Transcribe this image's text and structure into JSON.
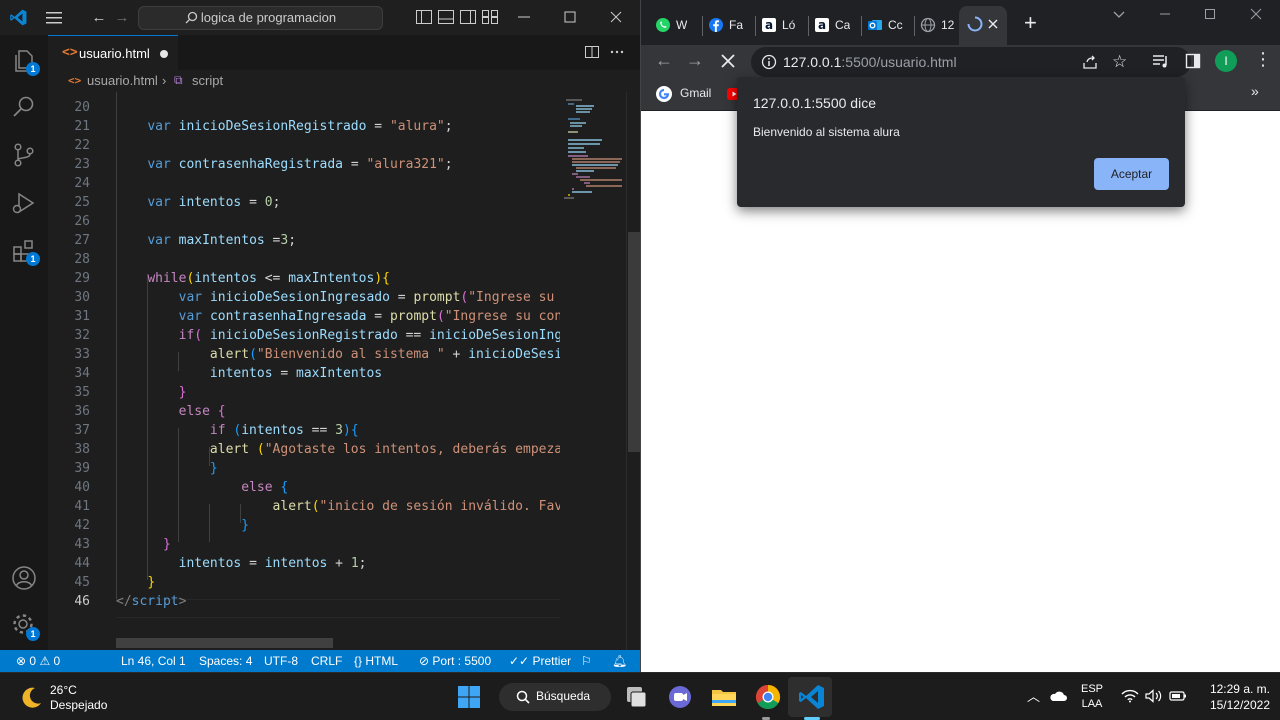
{
  "vscode": {
    "search_text": "logica de programacion",
    "tab": {
      "label": "usuario.html",
      "icon": "<>"
    },
    "breadcrumb": {
      "file": "usuario.html",
      "symbol": "script"
    },
    "activity_badges": {
      "explorer": "1",
      "extensions": "1",
      "settings": "1"
    },
    "status": {
      "problems": "0",
      "warnings": "0",
      "position": "Ln 46, Col 1",
      "spaces": "Spaces: 4",
      "encoding": "UTF-8",
      "eol": "CRLF",
      "language": "HTML",
      "port": "Port : 5500",
      "prettier": "Prettier"
    },
    "line_numbers": [
      "20",
      "21",
      "22",
      "23",
      "24",
      "25",
      "26",
      "27",
      "28",
      "29",
      "30",
      "31",
      "32",
      "33",
      "34",
      "35",
      "36",
      "37",
      "38",
      "39",
      "40",
      "41",
      "42",
      "43",
      "44",
      "45",
      "46"
    ],
    "code": {
      "l21": [
        "var",
        "inicioDeSesionRegistrado",
        " = ",
        "\"alura\"",
        ";"
      ],
      "l23": [
        "var",
        "contrasenhaRegistrada",
        " = ",
        "\"alura321\"",
        ";"
      ],
      "l25": [
        "var",
        "intentos",
        " = ",
        "0",
        ";"
      ],
      "l27": [
        "var",
        "maxIntentos",
        " =",
        "3",
        ";"
      ],
      "l29": [
        "while",
        "(",
        "intentos",
        " <= ",
        "maxIntentos",
        ")",
        "{"
      ],
      "l30": [
        "var",
        "inicioDeSesionIngresado",
        " = ",
        "prompt",
        "(",
        "\"Ingrese su u"
      ],
      "l31": [
        "var",
        "contrasenhaIngresada",
        " = ",
        "prompt",
        "(",
        "\"Ingrese su cont"
      ],
      "l32": [
        "if",
        "( ",
        "inicioDeSesionRegistrado",
        " == ",
        "inicioDeSesionIngr"
      ],
      "l33": [
        "alert",
        "(",
        "\"Bienvenido al sistema \"",
        " + ",
        "inicioDeSesio"
      ],
      "l34": [
        "intentos",
        " = ",
        "maxIntentos"
      ],
      "l35": [
        "}"
      ],
      "l36": [
        "else",
        " ",
        "{"
      ],
      "l37": [
        "if",
        " (",
        "intentos",
        " == ",
        "3",
        ")",
        "{"
      ],
      "l38": [
        "alert",
        " (",
        "\"Agotaste los intentos, deberás empezar"
      ],
      "l39": [
        "}"
      ],
      "l40": [
        "else",
        " ",
        "{"
      ],
      "l41": [
        "alert",
        "(",
        "\"inicio de sesión inválido. Favo"
      ],
      "l42": [
        "}"
      ],
      "l43": [
        "}"
      ],
      "l44": [
        "intentos",
        " = ",
        "intentos",
        " + ",
        "1",
        ";"
      ],
      "l45": [
        "}"
      ],
      "l46": [
        "</",
        "script",
        ">"
      ]
    }
  },
  "chrome": {
    "tabs": [
      {
        "icon": "whatsapp-icon",
        "label": "W"
      },
      {
        "icon": "facebook-icon",
        "label": "Fa"
      },
      {
        "icon": "alura-icon",
        "label": "Ló"
      },
      {
        "icon": "alura-icon",
        "label": "Ca"
      },
      {
        "icon": "outlook-icon",
        "label": "Cc"
      },
      {
        "icon": "globe-icon",
        "label": "12"
      }
    ],
    "url_host": "127.0.0.1",
    "url_rest": ":5500/usuario.html",
    "bookmarks": [
      {
        "label": "Gmail"
      }
    ],
    "profile_initial": "I",
    "dialog": {
      "title": "127.0.0.1:5500 dice",
      "message": "Bienvenido al sistema alura",
      "ok": "Aceptar"
    }
  },
  "taskbar": {
    "weather_temp": "26°C",
    "weather_desc": "Despejado",
    "search_label": "Búsqueda",
    "lang_top": "ESP",
    "lang_bottom": "LAA",
    "time": "12:29 a. m.",
    "date": "15/12/2022"
  },
  "colors": {
    "vscode_bg": "#1e1e1e",
    "statusbar": "#007acc",
    "chrome_frame": "#202124",
    "dialog_bg": "#292a2d",
    "dialog_button": "#8ab4f8"
  }
}
